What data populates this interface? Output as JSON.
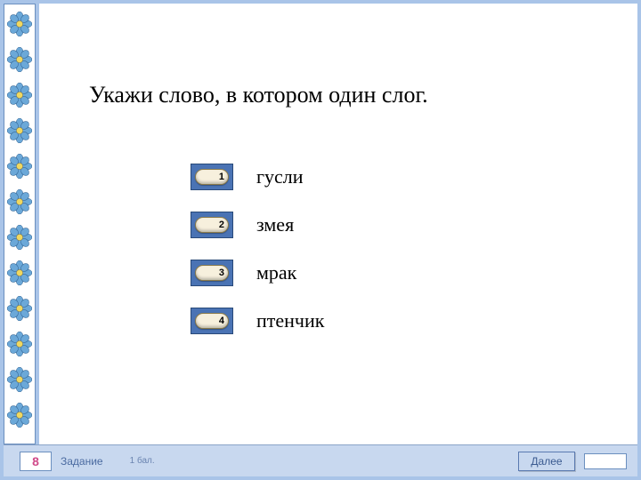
{
  "question": "Укажи слово, в котором один слог.",
  "options": [
    {
      "num": "1",
      "text": "гусли"
    },
    {
      "num": "2",
      "text": "змея"
    },
    {
      "num": "3",
      "text": "мрак"
    },
    {
      "num": "4",
      "text": "птенчик"
    }
  ],
  "footer": {
    "task_number": "8",
    "task_label": "Задание",
    "points": "1 бал.",
    "next_label": "Далее"
  }
}
